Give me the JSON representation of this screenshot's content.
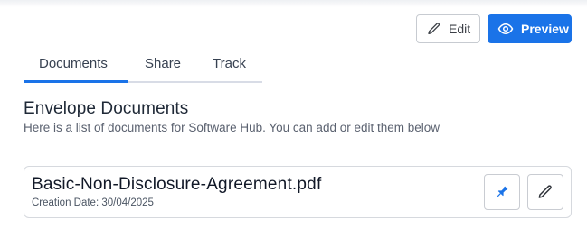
{
  "toolbar": {
    "edit_label": "Edit",
    "preview_label": "Preview",
    "edit_icon": "pencil-icon",
    "preview_icon": "eye-icon"
  },
  "tabs": [
    {
      "label": "Documents",
      "active": true
    },
    {
      "label": "Share",
      "active": false
    },
    {
      "label": "Track",
      "active": false
    }
  ],
  "section": {
    "title": "Envelope Documents",
    "description_prefix": "Here is a list of documents for ",
    "link_text": "Software Hub",
    "description_suffix": ". You can add or edit them below"
  },
  "documents": [
    {
      "name": "Basic-Non-Disclosure-Agreement.pdf",
      "creation_date": "Creation Date: 30/04/2025",
      "actions": [
        "pin-icon",
        "pencil-icon"
      ]
    }
  ],
  "colors": {
    "accent": "#1a73e8",
    "border": "#d6d9de"
  }
}
